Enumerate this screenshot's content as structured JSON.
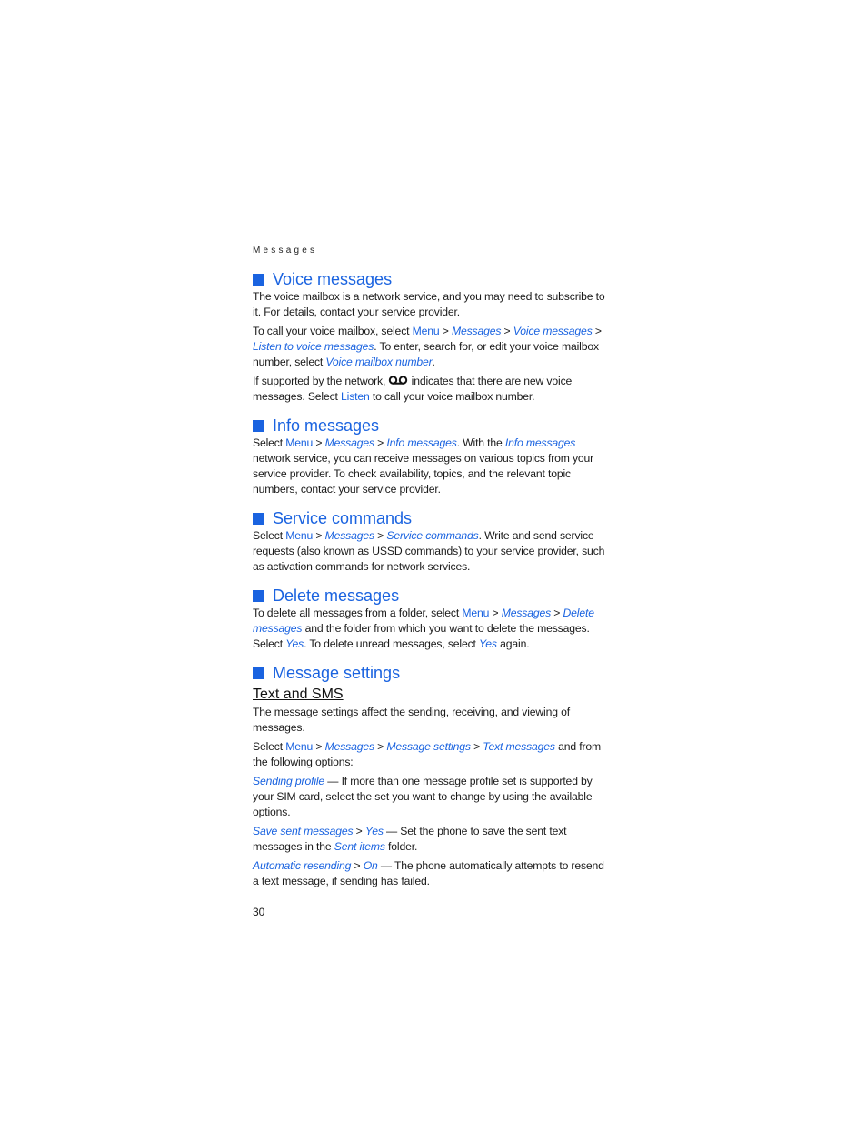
{
  "running_head": "Messages",
  "page_number": "30",
  "colors": {
    "accent": "#1a63e0",
    "text": "#1a1a1a"
  },
  "sections": {
    "voice": {
      "title": "Voice messages",
      "p1": "The voice mailbox is a network service, and you may need to subscribe to it. For details, contact your service provider.",
      "p2": {
        "t1": "To call your voice mailbox, select ",
        "menu": "Menu",
        "sep": " > ",
        "messages": "Messages",
        "voice_messages": "Voice messages",
        "listen": "Listen to voice messages",
        "t2": ". To enter, search for, or edit your voice mailbox number, select ",
        "mailbox_number": "Voice mailbox number",
        "t3": "."
      },
      "p3": {
        "t1": "If supported by the network, ",
        "icon": "voicemail-icon",
        "t2": " indicates that there are new voice messages. Select ",
        "listen": "Listen",
        "t3": " to call your voice mailbox number."
      }
    },
    "info": {
      "title": "Info messages",
      "t1": "Select ",
      "menu": "Menu",
      "sep": " > ",
      "messages": "Messages",
      "info_messages": "Info messages",
      "t2": ". With the ",
      "t3": " network service, you can receive messages on various topics from your service provider. To check availability, topics, and the relevant topic numbers, contact your service provider."
    },
    "service": {
      "title": "Service commands",
      "t1": "Select ",
      "menu": "Menu",
      "sep": " > ",
      "messages": "Messages",
      "service_commands": "Service commands",
      "t2": ". Write and send service requests (also known as USSD commands) to your service provider, such as activation commands for network services."
    },
    "delete": {
      "title": "Delete messages",
      "t1": "To delete all messages from a folder, select ",
      "menu": "Menu",
      "sep": " > ",
      "messages": "Messages",
      "delete_messages": "Delete messages",
      "t2": " and the folder from which you want to delete the messages. Select ",
      "yes": "Yes",
      "t3": ". To delete unread messages, select ",
      "t4": " again."
    },
    "settings": {
      "title": "Message settings",
      "subtitle": "Text and SMS",
      "p1": "The message settings affect the sending, receiving, and viewing of messages.",
      "p2": {
        "t1": "Select ",
        "menu": "Menu",
        "sep": " > ",
        "messages": "Messages",
        "message_settings": "Message settings",
        "text_messages": "Text messages",
        "t2": " and from the following options:"
      },
      "options": [
        {
          "name": "Sending profile",
          "value": "",
          "desc": " — If more than one message profile set is supported by your SIM card, select the set you want to change by using the available options."
        },
        {
          "name": "Save sent messages",
          "value": "Yes",
          "desc": " — Set the phone to save the sent text messages in the ",
          "link": "Sent items",
          "desc2": " folder."
        },
        {
          "name": "Automatic resending",
          "value": "On",
          "desc": " — The phone automatically attempts to resend a text message, if sending has failed."
        }
      ]
    }
  }
}
